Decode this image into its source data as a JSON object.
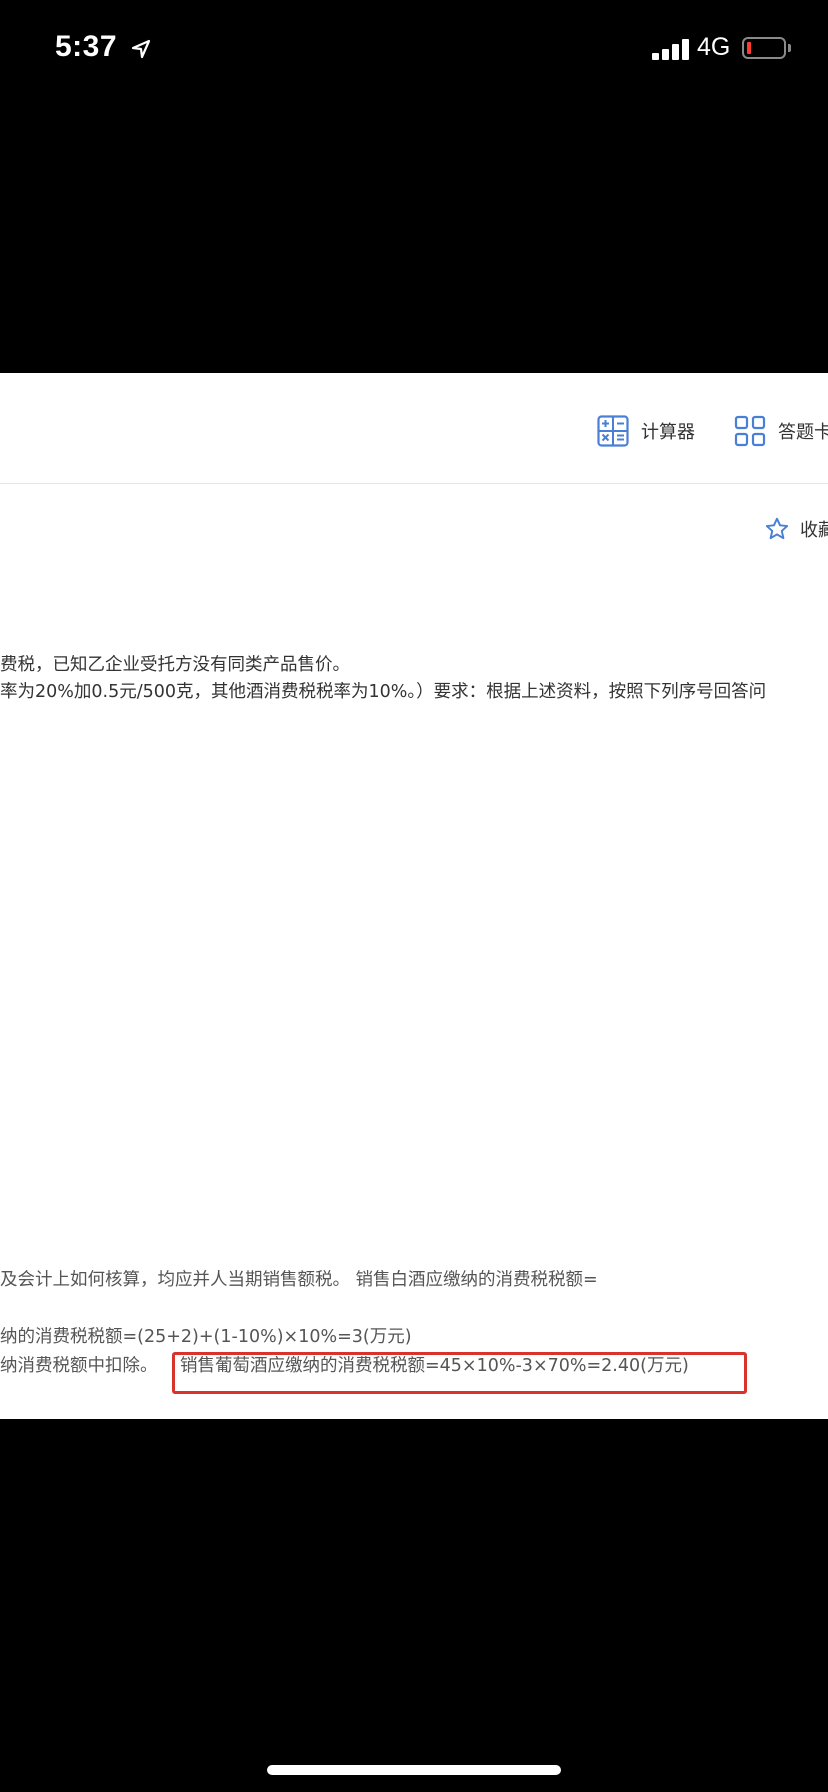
{
  "status_bar": {
    "time": "5:37",
    "network": "4G"
  },
  "toolbar": {
    "calculator_label": "计算器",
    "answer_card_label": "答题卡"
  },
  "favorite": {
    "label": "收藏"
  },
  "question": {
    "line1": "费税，已知乙企业受托方没有同类产品售价。",
    "line2": "率为20%加0.5元/500克，其他酒消费税税率为10%。）要求：根据上述资料，按照下列序号回答问"
  },
  "analysis": {
    "line1": "及会计上如何核算，均应并人当期销售额税。 销售白酒应缴纳的消费税税额=",
    "line2": "纳的消费税税额=(25+2)+(1-10%)×10%=3(万元)",
    "line3_prefix": "纳消费税额中扣除。",
    "line3_highlight": "销售葡萄酒应缴纳的消费税税额=45×10%-3×70%=2.40(万元)"
  }
}
